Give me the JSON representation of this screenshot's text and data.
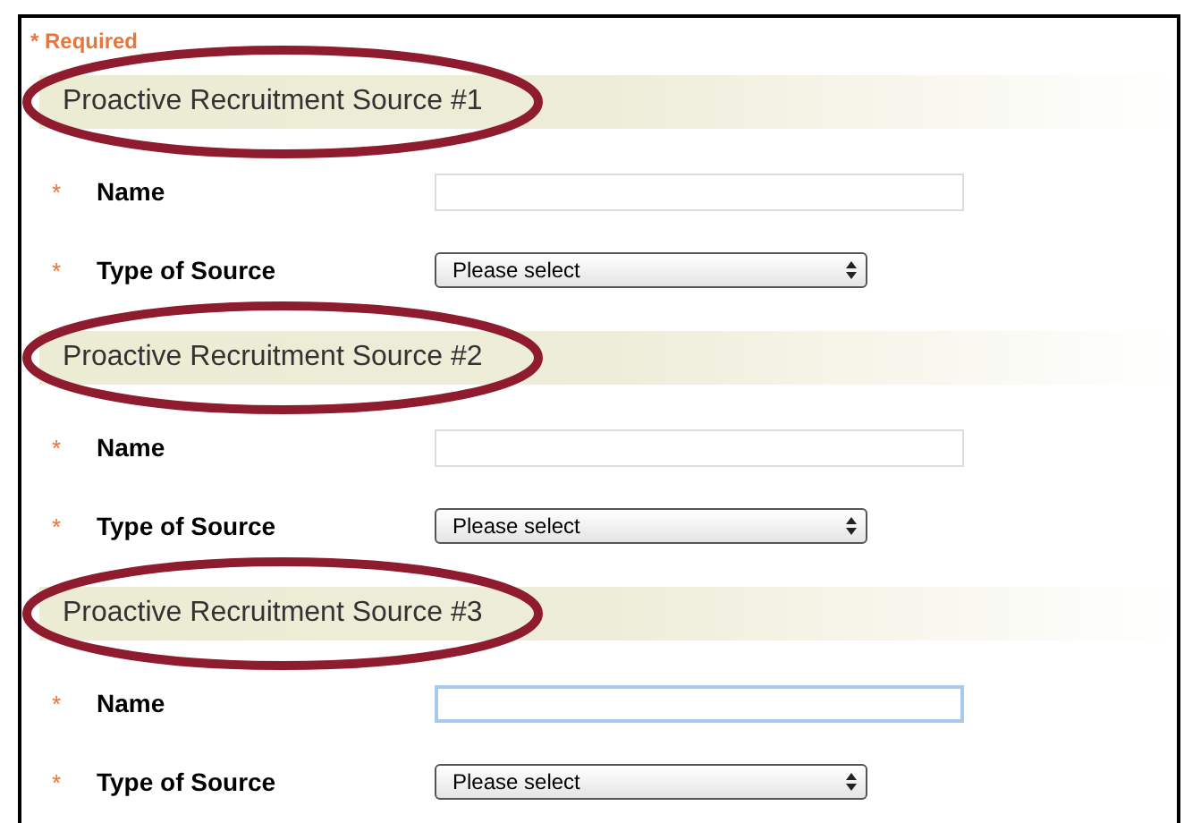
{
  "required_note": "* Required",
  "sections": [
    {
      "title": "Proactive Recruitment Source #1",
      "highlighted": true,
      "fields": [
        {
          "kind": "text",
          "required_mark": "*",
          "label": "Name",
          "focused": false
        },
        {
          "kind": "select",
          "required_mark": "*",
          "label": "Type of Source",
          "value": "Please select"
        }
      ]
    },
    {
      "title": "Proactive Recruitment Source #2",
      "highlighted": true,
      "fields": [
        {
          "kind": "text",
          "required_mark": "*",
          "label": "Name",
          "focused": false
        },
        {
          "kind": "select",
          "required_mark": "*",
          "label": "Type of Source",
          "value": "Please select"
        }
      ]
    },
    {
      "title": "Proactive Recruitment Source #3",
      "highlighted": true,
      "fields": [
        {
          "kind": "text",
          "required_mark": "*",
          "label": "Name",
          "focused": true
        },
        {
          "kind": "select",
          "required_mark": "*",
          "label": "Type of Source",
          "value": "Please select"
        }
      ]
    }
  ]
}
